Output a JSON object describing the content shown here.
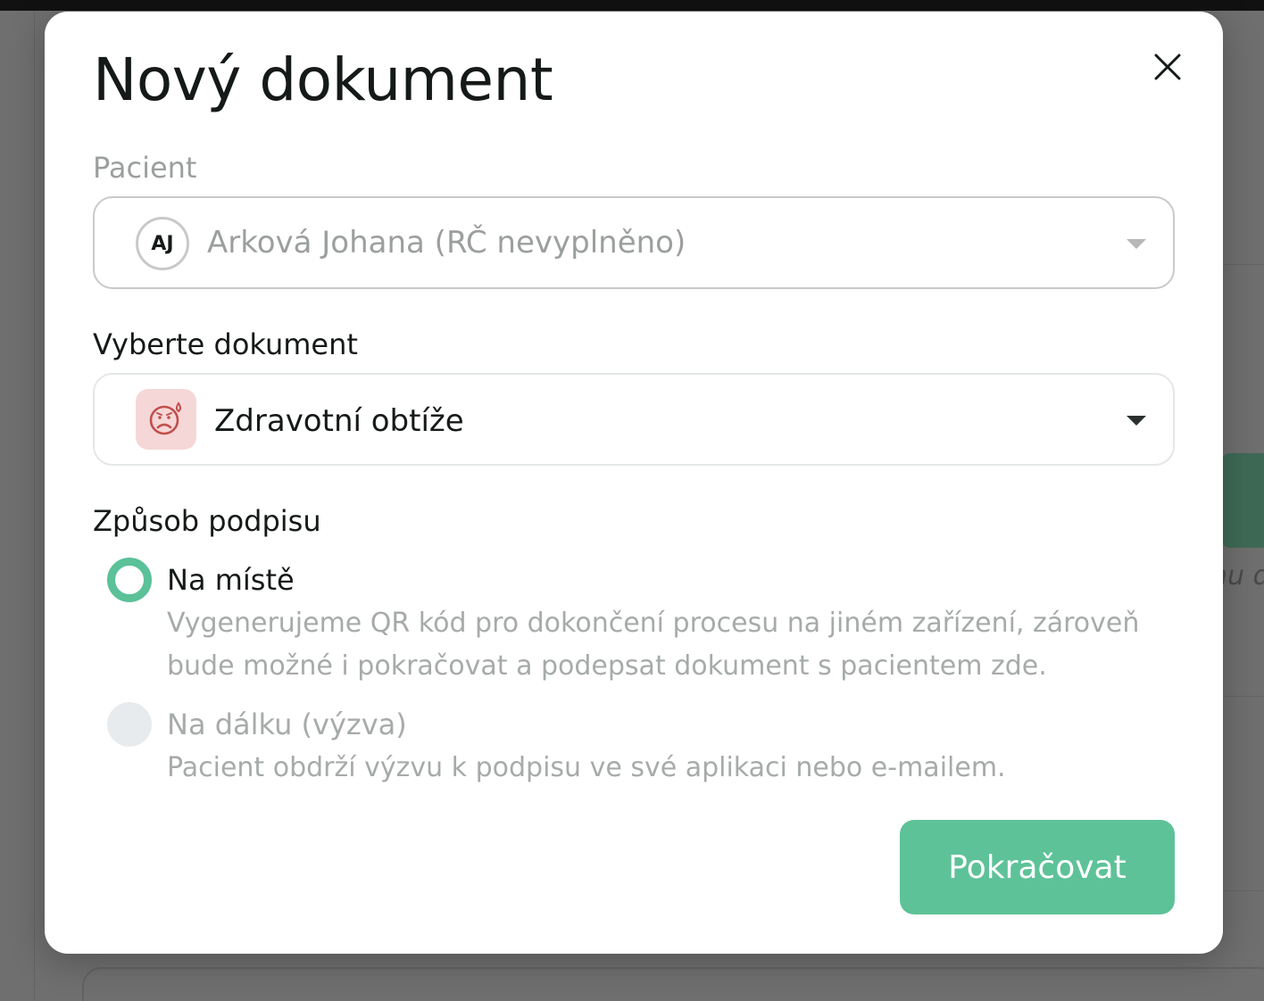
{
  "background": {
    "partial_text": "nu d"
  },
  "modal": {
    "title": "Nový dokument",
    "close_icon": "close-icon"
  },
  "patient_field": {
    "label": "Pacient",
    "avatar_initials": "AJ",
    "value": "Arková Johana (RČ nevyplněno)",
    "dropdown_icon": "chevron-down-icon"
  },
  "document_field": {
    "label": "Vyberte dokument",
    "icon": "sad-face-icon",
    "value": "Zdravotní obtíže",
    "dropdown_icon": "chevron-down-icon"
  },
  "signature": {
    "label": "Způsob podpisu",
    "options": [
      {
        "title": "Na místě",
        "description": "Vygenerujeme QR kód pro dokončení procesu na jiném zařízení, zároveň bude možné i pokračovat a podepsat dokument s pacientem zde.",
        "selected": true
      },
      {
        "title": "Na dálku (výzva)",
        "description": "Pacient obdrží výzvu k podpisu ve své aplikaci nebo e-mailem.",
        "selected": false
      }
    ]
  },
  "actions": {
    "continue_label": "Pokračovat"
  },
  "colors": {
    "accent": "#5ec298",
    "radio_selected": "#5bc198",
    "doc_icon_bg": "#f6d7d7",
    "doc_icon_fg": "#c0504d"
  }
}
